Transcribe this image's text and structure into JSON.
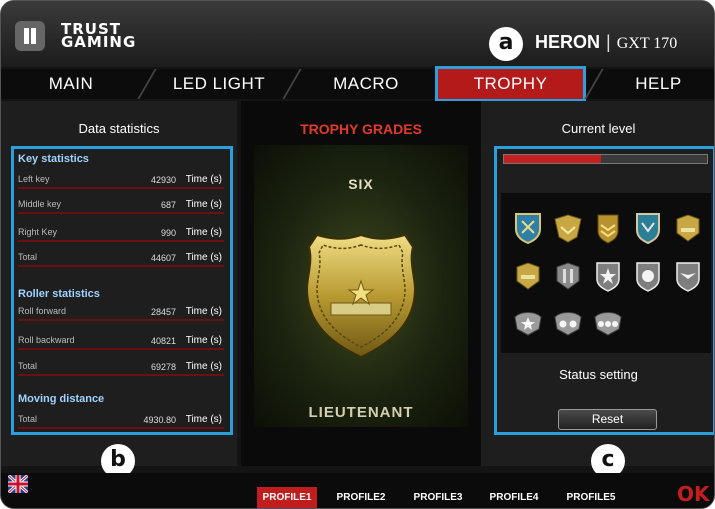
{
  "header": {
    "logo_line1": "TRUST",
    "logo_line2": "GAMING",
    "product_name": "HERON",
    "separator": "|",
    "model": "GXT 170"
  },
  "tabs": [
    {
      "label": "MAIN",
      "active": false
    },
    {
      "label": "LED LIGHT",
      "active": false
    },
    {
      "label": "MACRO",
      "active": false
    },
    {
      "label": "TROPHY",
      "active": true
    },
    {
      "label": "HELP",
      "active": false
    }
  ],
  "callouts": {
    "a": "a",
    "b": "b",
    "c": "c"
  },
  "left_panel": {
    "title": "Data statistics",
    "key_statistics": {
      "heading": "Key statistics",
      "rows": [
        {
          "label": "Left key",
          "value": "42930",
          "unit": "Time (s)"
        },
        {
          "label": "Middle key",
          "value": "687",
          "unit": "Time (s)"
        },
        {
          "label": "Right Key",
          "value": "990",
          "unit": "Time (s)"
        },
        {
          "label": "Total",
          "value": "44607",
          "unit": "Time (s)"
        }
      ]
    },
    "roller_statistics": {
      "heading": "Roller statistics",
      "rows": [
        {
          "label": "Roll forward",
          "value": "28457",
          "unit": "Time (s)"
        },
        {
          "label": "Roll backward",
          "value": "40821",
          "unit": "Time (s)"
        },
        {
          "label": "Total",
          "value": "69278",
          "unit": "Time (s)"
        }
      ]
    },
    "moving_distance": {
      "heading": "Moving distance",
      "rows": [
        {
          "label": "Total",
          "value": "4930.80",
          "unit": "Time (s)"
        }
      ]
    }
  },
  "center_panel": {
    "title": "TROPHY GRADES",
    "level": "SIX",
    "rank": "LIEUTENANT"
  },
  "right_panel": {
    "title": "Current level",
    "progress": 0.48,
    "badges": [
      "shield-blue-badge",
      "wings-gold-badge",
      "chevron-gold-badge",
      "shield-blue-badge",
      "bar-gold-badge",
      "bar-gold-badge",
      "double-bar-silver-badge",
      "star-silver-badge",
      "star-silver-badge",
      "eagle-silver-badge",
      "one-star-silver-badge",
      "two-star-silver-badge",
      "three-star-silver-badge"
    ],
    "status_title": "Status setting",
    "reset_label": "Reset"
  },
  "footer": {
    "profiles": [
      "PROFILE1",
      "PROFILE2",
      "PROFILE3",
      "PROFILE4",
      "PROFILE5"
    ],
    "active_profile": 0,
    "ok_label": "OK"
  },
  "colors": {
    "accent_red": "#c01d1d",
    "highlight_blue": "#2aa0df",
    "background": "#141414"
  }
}
